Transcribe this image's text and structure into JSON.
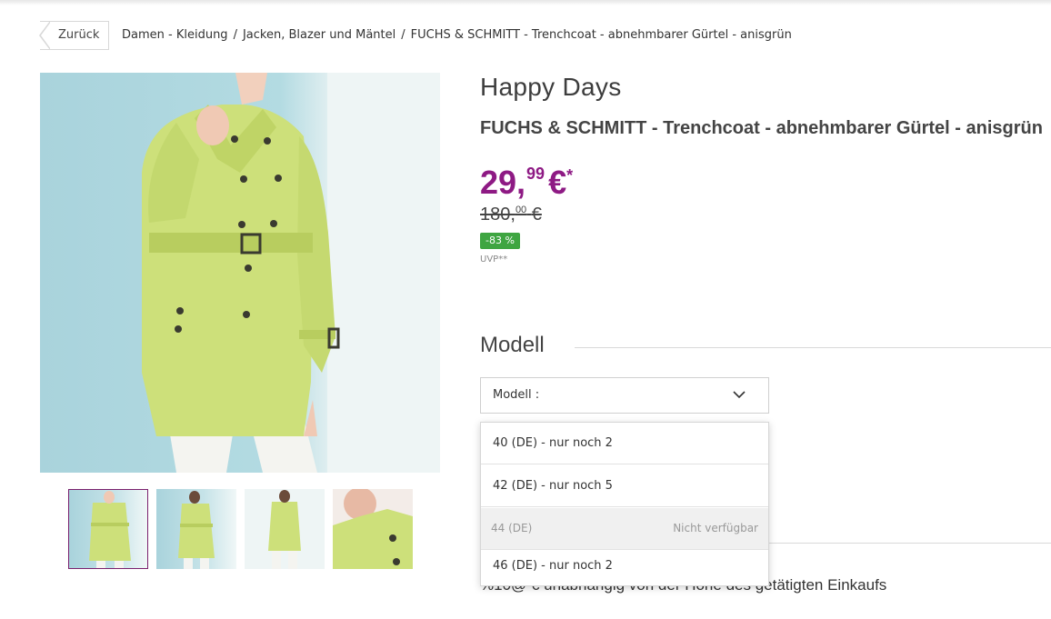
{
  "nav": {
    "back_label": "Zurück",
    "breadcrumb": [
      "Damen - Kleidung",
      "Jacken, Blazer und Mäntel",
      "FUCHS & SCHMITT - Trenchcoat - abnehmbarer Gürtel - anisgrün"
    ],
    "separator": "/"
  },
  "product": {
    "brand": "Happy Days",
    "title": "FUCHS & SCHMITT - Trenchcoat - abnehmbarer Gürtel - anisgrün",
    "price_int": "29,",
    "price_cents": "99",
    "price_currency": "€",
    "price_star": "*",
    "old_price_int": "180,",
    "old_price_cents": "00",
    "old_price_currency": "€",
    "discount": "-83 %",
    "uvp": "UVP**",
    "coat_color": "#cde07a"
  },
  "model": {
    "section_title": "Modell",
    "select_label": "Modell :",
    "options": [
      {
        "label": "40 (DE) - nur noch 2",
        "status": ""
      },
      {
        "label": "42 (DE) - nur noch 5",
        "status": ""
      },
      {
        "label": "44 (DE)",
        "status": "Nicht verfügbar"
      },
      {
        "label": "46 (DE) - nur noch 2",
        "status": ""
      }
    ]
  },
  "shipping_text": "%10@ € unabhängig von der Höhe des getätigten Einkaufs",
  "colors": {
    "price": "#8e1a84",
    "discount_badge": "#3ea541",
    "active_thumb_border": "#7a1f6d"
  }
}
